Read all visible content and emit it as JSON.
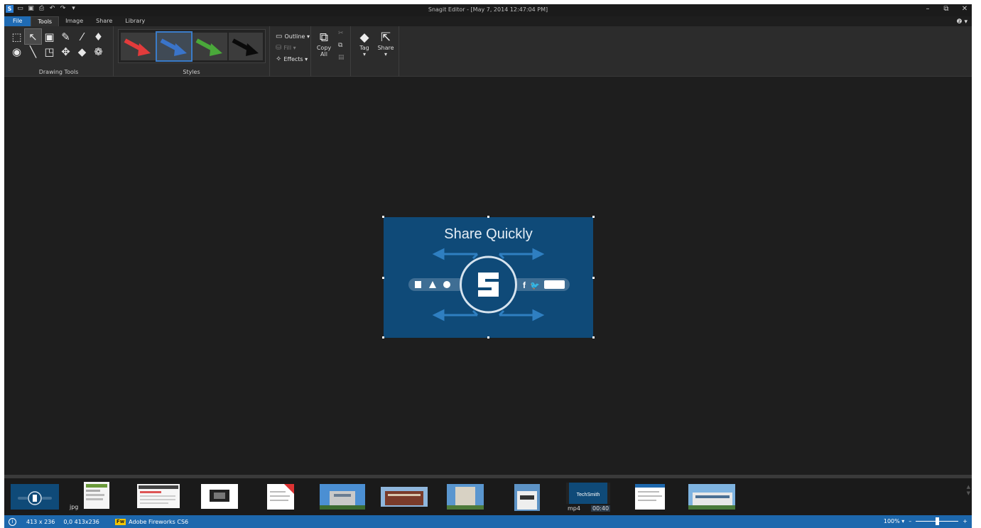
{
  "window": {
    "title": "Snagit Editor - [May 7, 2014 12:47:04 PM]",
    "controls": {
      "minimize": "–",
      "restore": "⧉",
      "close": "✕"
    },
    "help": "❷ ▾"
  },
  "quick_access": [
    {
      "icon": "snagit-logo-icon",
      "glyph": "S"
    },
    {
      "icon": "open-folder-icon",
      "glyph": "▭"
    },
    {
      "icon": "save-icon",
      "glyph": "▣"
    },
    {
      "icon": "print-icon",
      "glyph": "⎙"
    },
    {
      "icon": "undo-icon",
      "glyph": "↶"
    },
    {
      "icon": "redo-icon",
      "glyph": "↷"
    },
    {
      "icon": "customize-icon",
      "glyph": "▾"
    }
  ],
  "menu_tabs": [
    {
      "label": "File",
      "kind": "file"
    },
    {
      "label": "Tools",
      "kind": "active"
    },
    {
      "label": "Image",
      "kind": ""
    },
    {
      "label": "Share",
      "kind": ""
    },
    {
      "label": "Library",
      "kind": ""
    }
  ],
  "ribbon": {
    "drawing_tools": {
      "label": "Drawing Tools",
      "tools": [
        {
          "icon": "selection-icon",
          "glyph": "⬚"
        },
        {
          "icon": "arrow-icon",
          "glyph": "↖",
          "selected": true
        },
        {
          "icon": "stamp-icon",
          "glyph": "▣"
        },
        {
          "icon": "pen-icon",
          "glyph": "✎"
        },
        {
          "icon": "highlighter-icon",
          "glyph": "⁄"
        },
        {
          "icon": "fill-icon",
          "glyph": "♦"
        },
        {
          "icon": "callout-icon",
          "glyph": "◉"
        },
        {
          "icon": "line-icon",
          "glyph": "╲"
        },
        {
          "icon": "shape-icon",
          "glyph": "◳"
        },
        {
          "icon": "move-icon",
          "glyph": "✥"
        },
        {
          "icon": "eraser-icon",
          "glyph": "◆"
        },
        {
          "icon": "blur-icon",
          "glyph": "❁"
        }
      ]
    },
    "styles": {
      "label": "Styles",
      "swatches": [
        {
          "color": "#e23b3b",
          "selected": false
        },
        {
          "color": "#3a74c9",
          "selected": true
        },
        {
          "color": "#4aa83a",
          "selected": false
        },
        {
          "color": "#0a0a0a",
          "selected": false
        }
      ]
    },
    "quick_styles": {
      "outline": "Outline ▾",
      "fill": "Fill ▾",
      "effects": "Effects ▾"
    },
    "clipboard": {
      "copy_all": "Copy",
      "copy_all_2": "All"
    },
    "share": {
      "tag": "Tag",
      "share": "Share",
      "arrow": "▾"
    }
  },
  "capture": {
    "title": "Share Quickly",
    "colors": {
      "bg": "#0f4a78",
      "accent": "#1f6aa5"
    }
  },
  "tray": {
    "file_types": {
      "jpg": "jpg",
      "mp4": "mp4"
    },
    "video_duration": "00:40",
    "techsmith": "TechSmith"
  },
  "statusbar": {
    "info_icon": "i",
    "dimensions": "413 x 236",
    "selection": "0,0  413x236",
    "fw_badge": "Fw",
    "app": "Adobe Fireworks CS6",
    "zoom": "100%  ▾",
    "zoom_out": "–",
    "zoom_in": "+"
  }
}
